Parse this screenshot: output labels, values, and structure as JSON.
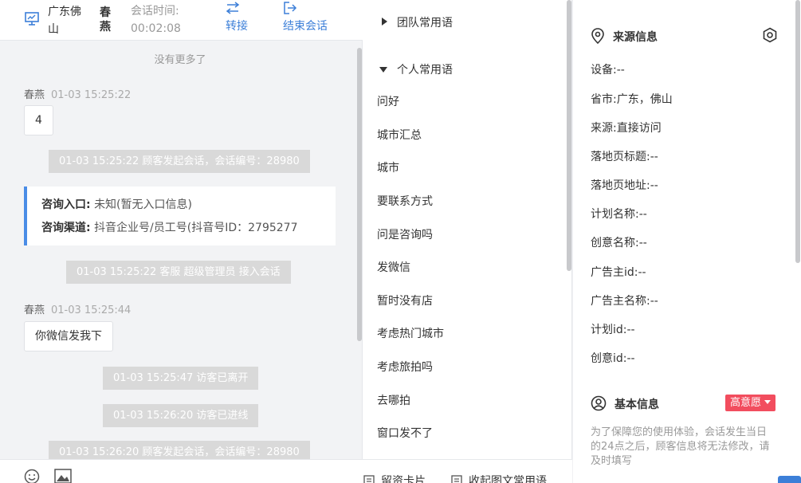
{
  "header": {
    "location": "广东佛山",
    "visitor_name": "春燕",
    "time_label": "会话时间:",
    "time_value": "00:02:08",
    "transfer_label": "转接",
    "end_label": "结束会话"
  },
  "chat": {
    "no_more": "没有更多了",
    "messages": [
      {
        "sender": "春燕",
        "time": "01-03 15:25:22",
        "text": "4"
      },
      {
        "sender": "春燕",
        "time": "01-03 15:25:44",
        "text": "你微信发我下"
      }
    ],
    "system": [
      "01-03 15:25:22 顾客发起会话，会话编号：28980",
      "01-03 15:25:22 客服 超级管理员 接入会话",
      "01-03 15:25:47 访客已离开",
      "01-03 15:26:20 访客已进线",
      "01-03 15:26:20 顾客发起会话，会话编号：28980"
    ],
    "info_card": {
      "entry_label": "咨询入口:",
      "entry_value": "未知(暂无入口信息)",
      "channel_label": "咨询渠道:",
      "channel_value": "抖音企业号/员工号(抖音号ID：2795277"
    }
  },
  "footer": {
    "card_label": "留资卡片",
    "phrases_label": "收起图文常用语"
  },
  "phrases": {
    "team_group": "团队常用语",
    "personal_group": "个人常用语",
    "items": [
      "问好",
      "城市汇总",
      "城市",
      "要联系方式",
      "问是咨询吗",
      "发微信",
      "暂时没有店",
      "考虑热门城市",
      "考虑旅拍吗",
      "去哪拍",
      "窗口发不了"
    ]
  },
  "source": {
    "title": "来源信息",
    "rows": [
      {
        "label": "设备:",
        "value": "--"
      },
      {
        "label": "省市:",
        "value": "广东，佛山"
      },
      {
        "label": "来源:",
        "value": "直接访问"
      },
      {
        "label": "落地页标题:",
        "value": "--"
      },
      {
        "label": "落地页地址:",
        "value": "--"
      },
      {
        "label": "计划名称:",
        "value": "--"
      },
      {
        "label": "创意名称:",
        "value": "--"
      },
      {
        "label": "广告主id:",
        "value": "--"
      },
      {
        "label": "广告主名称:",
        "value": "--"
      },
      {
        "label": "计划id:",
        "value": "--"
      },
      {
        "label": "创意id:",
        "value": "--"
      }
    ]
  },
  "basic": {
    "title": "基本信息",
    "badge": "高意愿",
    "notice": "为了保障您的使用体验，会话发生当日的24点之后，顾客信息将无法修改，请及时填写"
  },
  "colors": {
    "accent": "#3c7fd8",
    "badge": "#f24d5e",
    "card_border": "#4a8ce6"
  }
}
